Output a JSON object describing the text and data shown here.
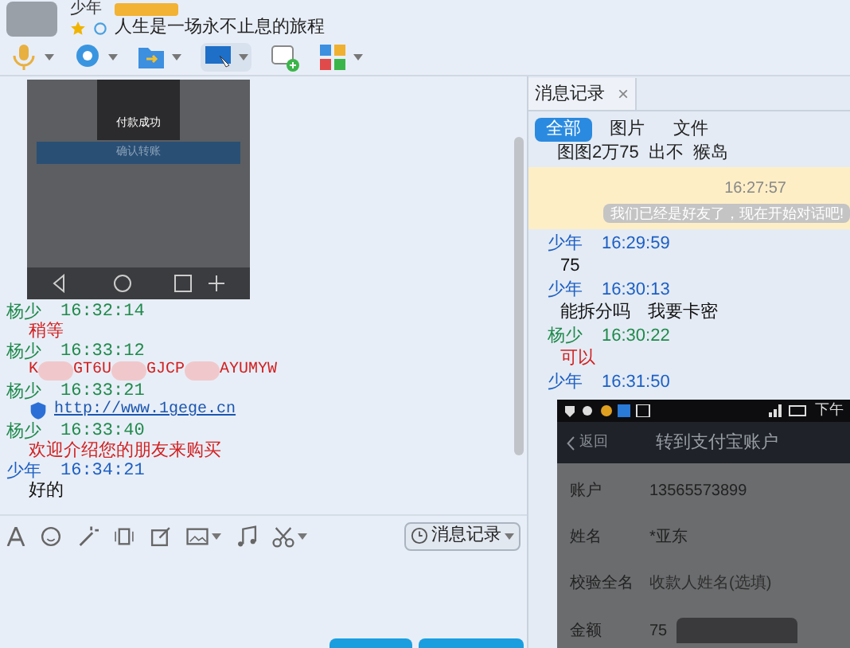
{
  "contact": {
    "name": "少年",
    "signature": "人生是一场永不止息的旅程"
  },
  "chat_image": {
    "toast": "付款成功",
    "button": "确认转账"
  },
  "messages": [
    {
      "sender": {
        "name": "杨少",
        "color": "#1f8a4c"
      },
      "time": "16:32:14",
      "kind": "text",
      "color": "#d22020",
      "parts": [
        "稍等"
      ]
    },
    {
      "sender": {
        "name": "杨少",
        "color": "#1f8a4c"
      },
      "time": "16:33:12",
      "kind": "redacted",
      "color": "#d22020",
      "parts": [
        "K",
        "GT6U",
        "GJCP",
        "AYUMYW"
      ]
    },
    {
      "sender": {
        "name": "杨少",
        "color": "#1f8a4c"
      },
      "time": "16:33:21",
      "kind": "link",
      "color": "#1a56b0",
      "parts": [
        "http://www.1gege.cn"
      ]
    },
    {
      "sender": {
        "name": "杨少",
        "color": "#1f8a4c"
      },
      "time": "16:33:40",
      "kind": "text",
      "color": "#d22020",
      "parts": [
        "欢迎介绍您的朋友来购买"
      ]
    },
    {
      "sender": {
        "name": "少年",
        "color": "#1d5fc4"
      },
      "time": "16:34:21",
      "kind": "text",
      "color": "#111111",
      "parts": [
        "好的"
      ]
    }
  ],
  "history_button": "消息记录",
  "panel": {
    "tab": "消息记录",
    "close": "×",
    "filters": [
      {
        "label": "全部",
        "selected": true
      },
      {
        "label": "图片",
        "selected": false
      },
      {
        "label": "文件",
        "selected": false
      }
    ],
    "top_message": "图图2万75  出不  猴岛",
    "system": {
      "time": "16:27:57",
      "text": "我们已经是好友了，现在开始对话吧!"
    },
    "messages": [
      {
        "sender": {
          "name": "少年",
          "color": "#1d5fc4"
        },
        "time": "16:29:59",
        "text": "75",
        "color": "#111111"
      },
      {
        "sender": {
          "name": "少年",
          "color": "#1d5fc4"
        },
        "time": "16:30:13",
        "text": "能拆分吗　我要卡密",
        "color": "#111111"
      },
      {
        "sender": {
          "name": "杨少",
          "color": "#1f8a4c"
        },
        "time": "16:30:22",
        "text": "可以",
        "color": "#d22020"
      },
      {
        "sender": {
          "name": "少年",
          "color": "#1d5fc4"
        },
        "time": "16:31:50"
      }
    ],
    "phone": {
      "status": "下午",
      "back": "返回",
      "title": "转到支付宝账户",
      "rows": [
        {
          "label": "账户",
          "value": "13565573899"
        },
        {
          "label": "姓名",
          "value": "*亚东"
        },
        {
          "label": "校验全名",
          "placeholder": "收款人姓名(选填)"
        },
        {
          "label": "金额",
          "value": "75"
        }
      ]
    }
  }
}
